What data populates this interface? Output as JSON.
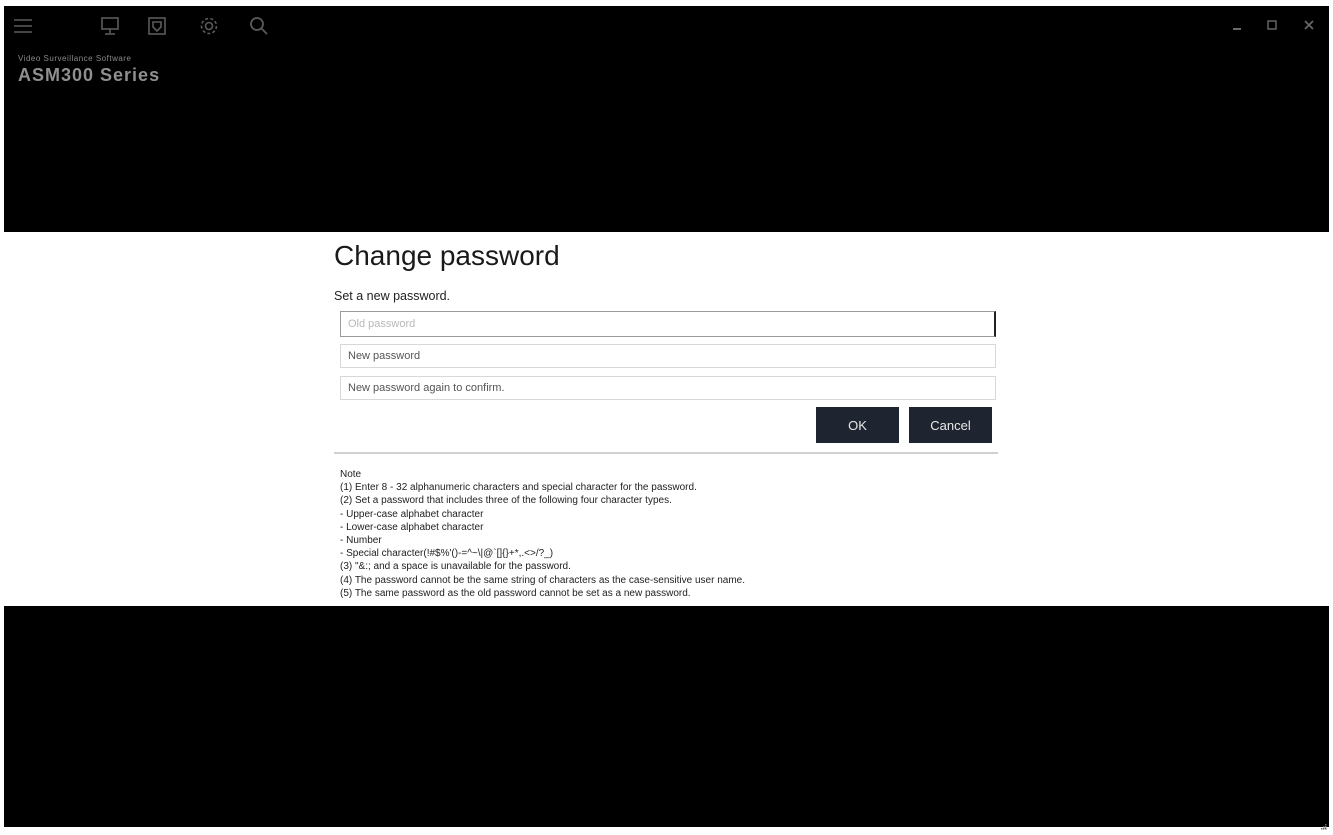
{
  "titlebar": {
    "icons": [
      "menu-icon",
      "monitor-icon",
      "map-icon",
      "gear-icon",
      "search-icon"
    ],
    "window_controls": [
      "minimize-icon",
      "maximize-icon",
      "close-icon"
    ]
  },
  "brand": {
    "subtitle": "Video Surveillance Software",
    "name": "ASM300 Series"
  },
  "dialog": {
    "title": "Change password",
    "subtitle": "Set a new password.",
    "old_password_placeholder": "Old password",
    "new_password_placeholder": "New password",
    "confirm_password_placeholder": "New password again to confirm.",
    "ok_label": "OK",
    "cancel_label": "Cancel"
  },
  "notes": {
    "heading": "Note",
    "lines": [
      "(1) Enter 8 - 32 alphanumeric characters and special character for the password.",
      "(2) Set a password that includes three of the following four character types.",
      "- Upper-case alphabet character",
      "- Lower-case alphabet character",
      "- Number",
      "- Special character(!#$%'()-=^~\\|@`[]{}+*,.<>/?_)",
      "(3) \"&:; and a space is unavailable for the password.",
      "(4) The password cannot be the same string of characters as the case-sensitive user name.",
      "(5) The same password as the old password cannot be set as a new password."
    ]
  },
  "colors": {
    "background": "#000000",
    "panel": "#ffffff",
    "button": "#1f2530",
    "button_text": "#e8e8e8"
  }
}
